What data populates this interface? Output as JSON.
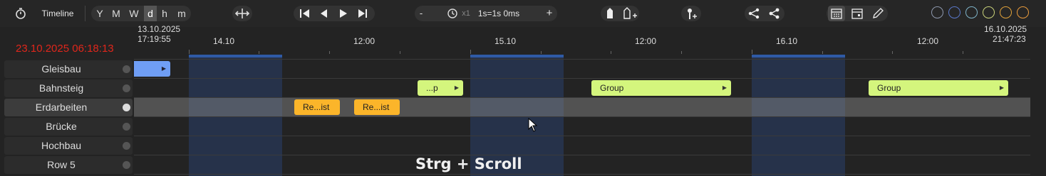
{
  "toolbar": {
    "timeline_label": "Timeline",
    "zoom_levels": [
      "Y",
      "M",
      "W",
      "d",
      "h",
      "m"
    ],
    "active_zoom": "d",
    "speed_minus": "-",
    "speed_multiplier": "x1",
    "speed_value": "1s=1s 0ms",
    "speed_plus": "+",
    "circle_colors": [
      "#8e98ad",
      "#5a78c9",
      "#7fb3c8",
      "#c9d27a",
      "#e0a23a",
      "#e89a3c"
    ]
  },
  "timeline": {
    "start_date": "13.10.2025",
    "start_time": "17:19:55",
    "end_date": "16.10.2025",
    "end_time": "21:47:23",
    "current_time": "23.10.2025 06:18:13",
    "axis_labels": [
      "14.10",
      "12:00",
      "15.10",
      "12:00",
      "16.10",
      "12:00"
    ]
  },
  "rows": [
    {
      "label": "Gleisbau"
    },
    {
      "label": "Bahnsteig"
    },
    {
      "label": "Erdarbeiten"
    },
    {
      "label": "Brücke"
    },
    {
      "label": "Hochbau"
    },
    {
      "label": "Row 5"
    }
  ],
  "items": {
    "gleisbau_item": "",
    "bahnsteig_item_1": "...p",
    "bahnsteig_item_2": "Group",
    "bahnsteig_item_3": "Group",
    "erdarbeiten_item_1": "Re...ist",
    "erdarbeiten_item_2": "Re...ist"
  },
  "colors": {
    "accent_blue": "#6f9ef5",
    "group_green": "#d4f57d",
    "resource_orange": "#fbb52a",
    "current_time_red": "#e0261b"
  },
  "hint": "Strg + Scroll"
}
